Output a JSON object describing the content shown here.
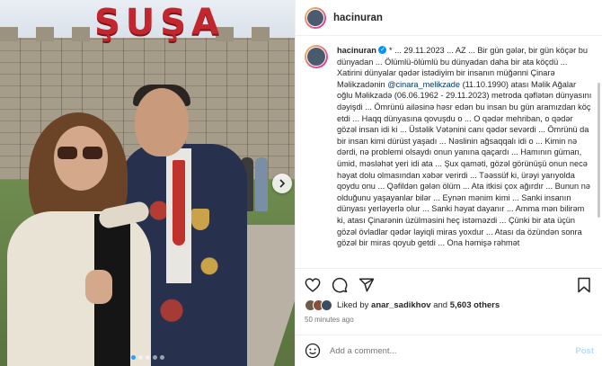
{
  "photo": {
    "sign_text": "ŞUŞA",
    "carousel_index": 1,
    "carousel_count": 5
  },
  "header": {
    "username": "hacinuran"
  },
  "caption": {
    "username": "hacinuran",
    "text_before_mention": "* ... 29.11.2023 ... AZ ... Bir gün gələr, bir gün köçər bu dünyadan ... Ölümlü-ölümlü bu dünyadan daha bir ata köçdü ... Xatirini dünyalar qədər istədiyim bir insanın müğənni Çinarə Məlikzadənin ",
    "mention": "@cinara_melikzade",
    "text_after_mention": " (11.10.1990) atası Məlik Ağalar oğlu Məlikzadə (06.06.1962 - 29.11.2023) metroda qəflətən dünyasını dəyişdi ... Ömrünü ailəsinə həsr edən bu insan bu gün aramızdan köç etdi ... Haqq dünyasına qovuşdu o ... O qədər mehriban, o qədər gözəl insan idi ki ... Üstəlik Vətənini canı qədər sevərdi ... Ömrünü da bir insan kimi dürüst yaşadı ... Nəslinin ağsaqqalı idi o ... Kimin nə dərdi, nə problemi olsaydı onun yanına qaçardı ... Hamının güman, ümid, məsləhət yeri idi ata ... Şux qaməti, gözəl görünüşü onun necə həyat dolu olmasından xəbər verirdi ... Təəssüf ki, ürəyi yarıyolda qoydu onu ... Qəfildən gələn ölüm ... Ata itkisi çox ağırdır ... Bunun nə olduğunu yaşayanlar bilər ... Eynən mənim kimi ... Sanki insanın dünyası yerləyerlə olur ... Sanki həyat dayanır ... Amma mən bilirəm ki, atası Çinarənin üzülməsini heç istəməzdi ... Çünki bir ata üçün gözəl övladlar qədər layiqli miras yoxdur ... Atası da özündən sonra gözəl bir miras qoyub getdi ... Ona həmişə rəhmət"
  },
  "likes": {
    "prefix": "Liked by",
    "first_user": "anar_sadikhov",
    "conjunction": "and",
    "others": "5,603 others"
  },
  "time_ago": "50 minutes ago",
  "comment": {
    "placeholder": "Add a comment...",
    "post_label": "Post"
  },
  "icons": {
    "like": "heart-icon",
    "comment": "comment-icon",
    "share": "share-icon",
    "save": "bookmark-icon",
    "emoji": "emoji-icon",
    "next": "chevron-right-icon"
  },
  "colors": {
    "verified": "#0095f6",
    "mention": "#00376b",
    "sign": "#c4262e",
    "post_disabled": "#b3dbff"
  }
}
